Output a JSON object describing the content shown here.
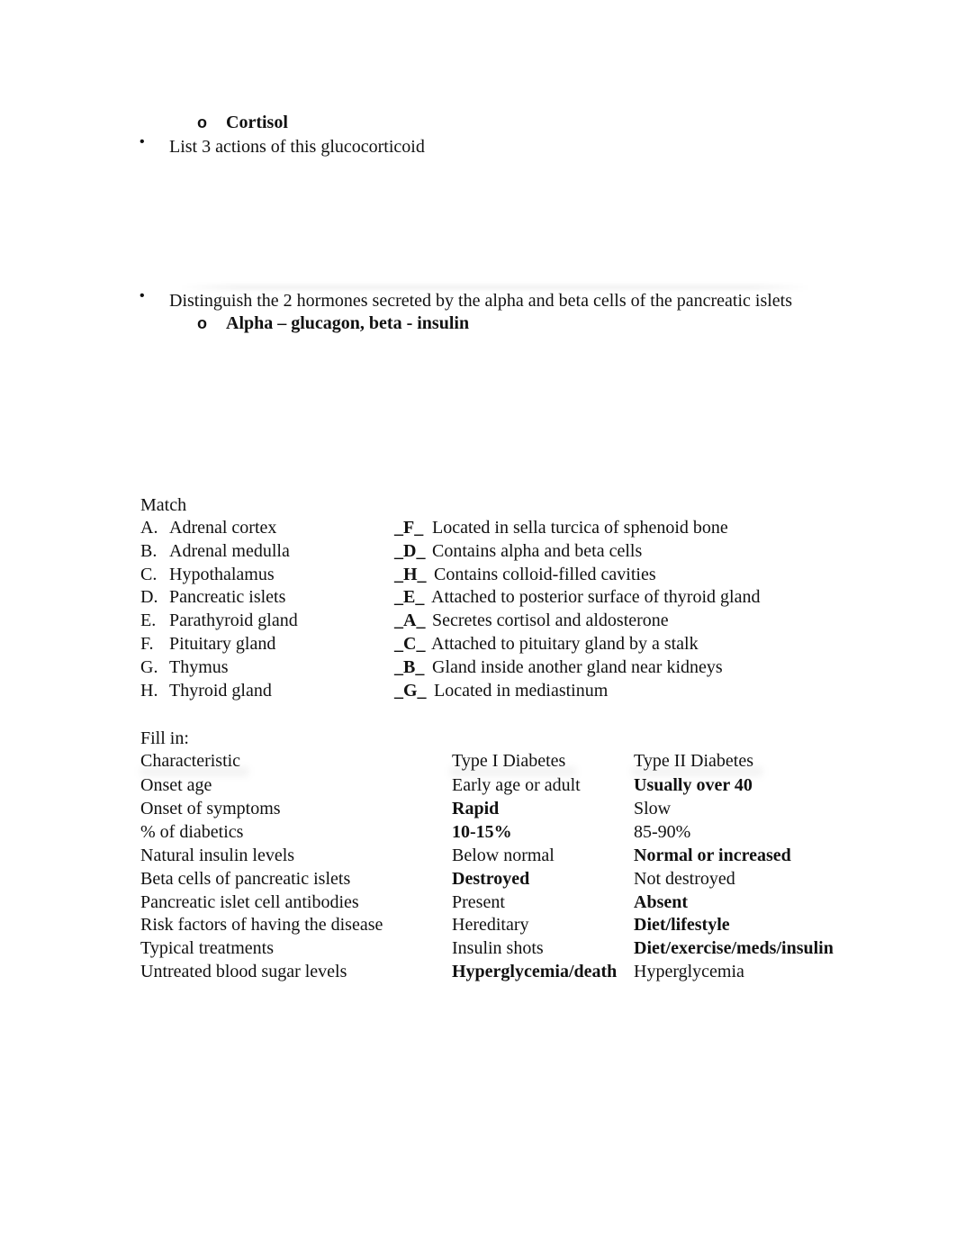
{
  "section1": {
    "sub_item": "Cortisol",
    "bullet1": "List 3 actions of this glucocorticoid",
    "bullet2": "Distinguish the 2 hormones secreted by the alpha and beta cells of the pancreatic islets",
    "answer2": "Alpha – glucagon, beta - insulin"
  },
  "match": {
    "title": "Match",
    "left": [
      {
        "letter": "A.",
        "name": "Adrenal cortex"
      },
      {
        "letter": "B.",
        "name": "Adrenal medulla"
      },
      {
        "letter": "C.",
        "name": "Hypothalamus"
      },
      {
        "letter": "D.",
        "name": "Pancreatic islets"
      },
      {
        "letter": "E.",
        "name": "Parathyroid gland"
      },
      {
        "letter": "F.",
        "name": "Pituitary gland"
      },
      {
        "letter": "G.",
        "name": "Thymus"
      },
      {
        "letter": "H.",
        "name": "Thyroid gland"
      }
    ],
    "right": [
      {
        "answer": "_F_",
        "text": "Located in sella turcica of sphenoid bone"
      },
      {
        "answer": "_D_",
        "text": "Contains alpha and beta cells"
      },
      {
        "answer": "_H_",
        "text": "Contains colloid-filled cavities"
      },
      {
        "answer": "_E_",
        "text": "Attached to posterior surface of thyroid gland"
      },
      {
        "answer": "_A_",
        "text": "Secretes cortisol and aldosterone"
      },
      {
        "answer": "_C_",
        "text": "Attached to pituitary gland by a stalk"
      },
      {
        "answer": "_B_",
        "text": "Gland inside another gland near kidneys"
      },
      {
        "answer": "_G_",
        "text": "Located in mediastinum"
      }
    ]
  },
  "fill": {
    "title": "Fill in:",
    "headers": [
      "Characteristic",
      "Type I Diabetes",
      "Type II Diabetes"
    ],
    "rows": [
      {
        "c": "Onset age",
        "t1": "Early age or adult",
        "t1b": false,
        "t2": "Usually over 40",
        "t2b": true
      },
      {
        "c": "Onset of symptoms",
        "t1": "Rapid",
        "t1b": true,
        "t2": "Slow",
        "t2b": false
      },
      {
        "c": "% of diabetics",
        "t1": "10-15%",
        "t1b": true,
        "t2": "85-90%",
        "t2b": false
      },
      {
        "c": "Natural insulin levels",
        "t1": "Below normal",
        "t1b": false,
        "t2": "Normal or increased",
        "t2b": true
      },
      {
        "c": "Beta cells of pancreatic islets",
        "t1": "Destroyed",
        "t1b": true,
        "t2": "Not destroyed",
        "t2b": false
      },
      {
        "c": "Pancreatic islet cell antibodies",
        "t1": "Present",
        "t1b": false,
        "t2": "Absent",
        "t2b": true
      },
      {
        "c": "Risk factors of having the disease",
        "t1": "Hereditary",
        "t1b": false,
        "t2": "Diet/lifestyle",
        "t2b": true
      },
      {
        "c": "Typical treatments",
        "t1": "Insulin shots",
        "t1b": false,
        "t2": "Diet/exercise/meds/insulin",
        "t2b": true
      },
      {
        "c": "Untreated blood sugar levels",
        "t1": "Hyperglycemia/death",
        "t1b": true,
        "t2": " Hyperglycemia",
        "t2b": false
      }
    ]
  }
}
